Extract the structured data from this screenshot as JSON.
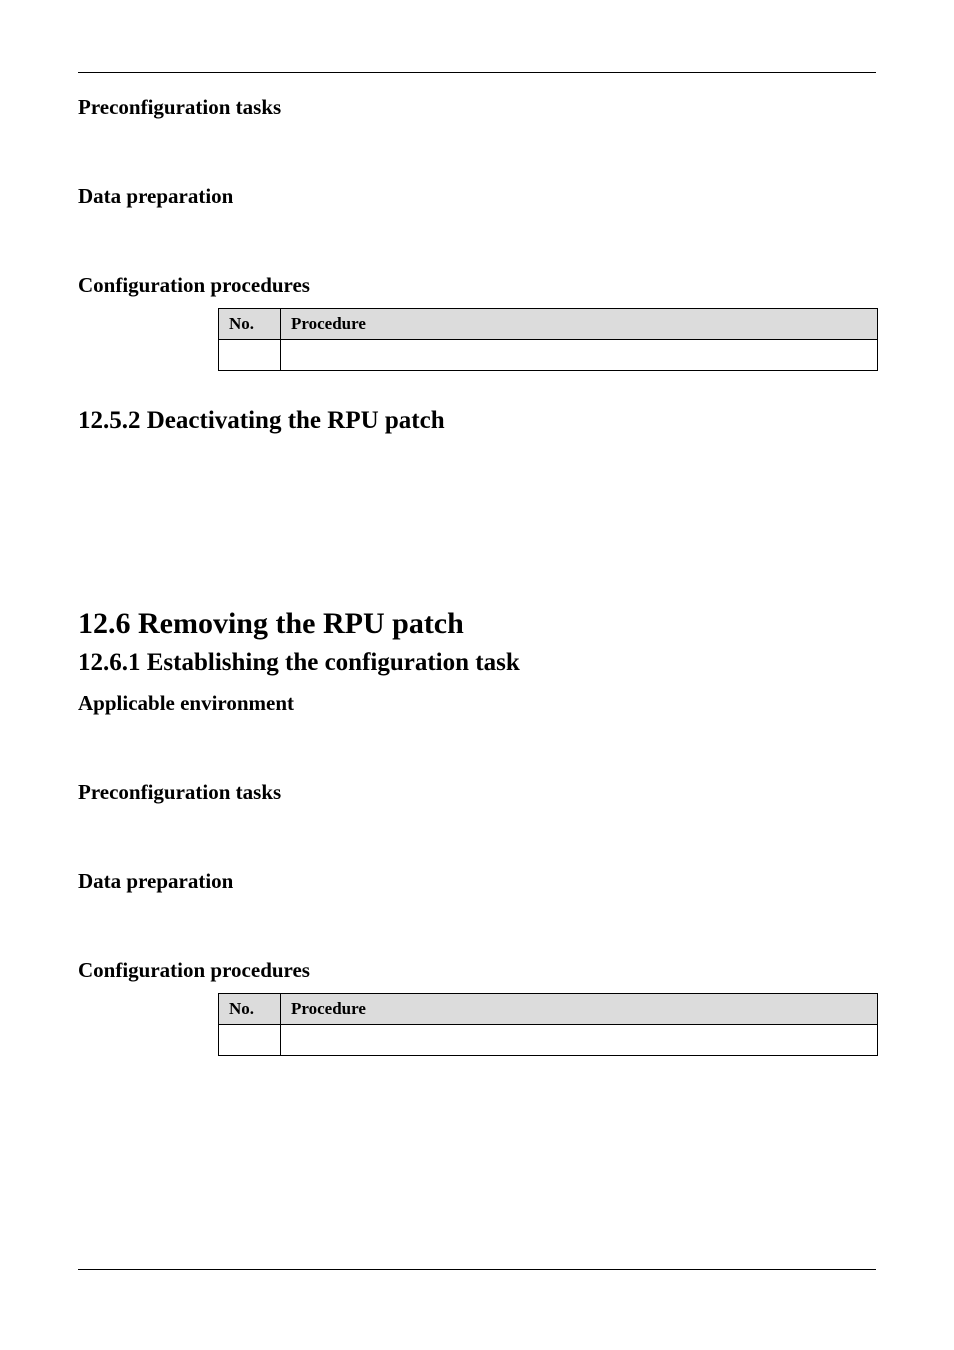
{
  "section_a": {
    "h_preconfig": "Preconfiguration tasks",
    "h_dataprep": "Data preparation",
    "h_configproc": "Configuration procedures",
    "table": {
      "col_no": "No.",
      "col_proc": "Procedure",
      "row1_no": "",
      "row1_proc": ""
    }
  },
  "section_b": {
    "h2": "12.5.2 Deactivating the RPU patch"
  },
  "section_c": {
    "h1": "12.6 Removing the RPU patch",
    "h2": "12.6.1 Establishing the configuration task",
    "h_appenv": "Applicable environment",
    "h_preconfig": "Preconfiguration tasks",
    "h_dataprep": "Data preparation",
    "h_configproc": "Configuration procedures",
    "table": {
      "col_no": "No.",
      "col_proc": "Procedure",
      "row1_no": "",
      "row1_proc": ""
    }
  }
}
